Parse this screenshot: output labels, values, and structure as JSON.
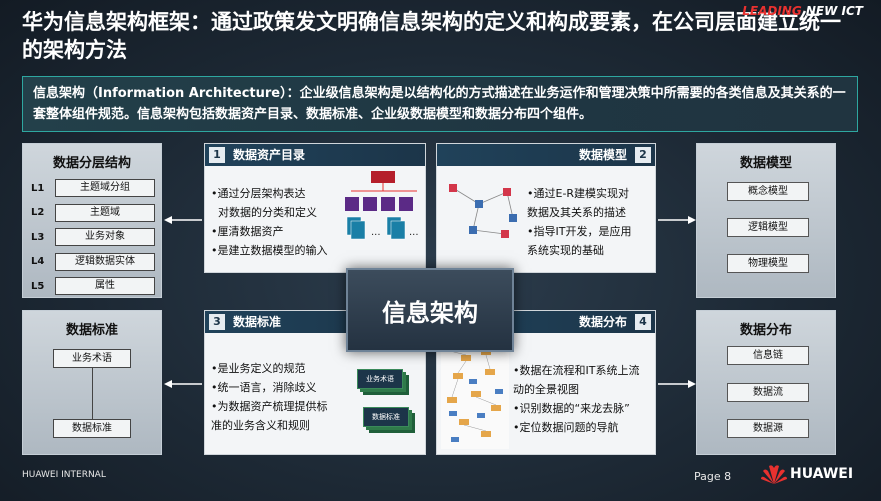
{
  "header": {
    "title": "华为信息架构框架：通过政策发文明确信息架构的定义和构成要素，在公司层面建立统一的架构方法",
    "tag_lead": "LEADING",
    "tag_ict": " NEW ICT"
  },
  "definition": {
    "text": "信息架构（Information Architecture）：企业级信息架构是以结构化的方式描述在业务运作和管理决策中所需要的各类信息及其关系的一套整体组件规范。信息架构包括数据资产目录、数据标准、企业级数据模型和数据分布四个组件。"
  },
  "left_top": {
    "title": "数据分层结构",
    "layers": [
      {
        "level": "L1",
        "label": "主题域分组"
      },
      {
        "level": "L2",
        "label": "主题域"
      },
      {
        "level": "L3",
        "label": "业务对象"
      },
      {
        "level": "L4",
        "label": "逻辑数据实体"
      },
      {
        "level": "L5",
        "label": "属性"
      }
    ]
  },
  "left_bottom": {
    "title": "数据标准",
    "items": [
      "业务术语",
      "数据标准"
    ]
  },
  "right_top": {
    "title": "数据模型",
    "items": [
      "概念模型",
      "逻辑模型",
      "物理模型"
    ]
  },
  "right_bottom": {
    "title": "数据分布",
    "items": [
      "信息链",
      "数据流",
      "数据源"
    ]
  },
  "panels": {
    "p1": {
      "num": "1",
      "title": "数据资产目录",
      "bullets": [
        "•通过分层架构表达",
        "  对数据的分类和定义",
        "•厘清数据资产",
        "•是建立数据模型的输入"
      ]
    },
    "p2": {
      "num": "2",
      "title": "数据模型",
      "bullets": [
        "•通过E-R建模实现对",
        "数据及其关系的描述",
        "•指导IT开发，是应用",
        "系统实现的基础"
      ]
    },
    "p3": {
      "num": "3",
      "title": "数据标准",
      "bullets": [
        "•是业务定义的规范",
        "•统一语言，消除歧义",
        "•为数据资产梳理提供标",
        "准的业务含义和规则"
      ],
      "stack_labels": [
        "业务术语",
        "数据标准"
      ]
    },
    "p4": {
      "num": "4",
      "title": "数据分布",
      "bullets": [
        "•数据在流程和IT系统上流",
        "动的全景视图",
        "•识别数据的“来龙去脉”",
        "•定位数据问题的导航"
      ]
    }
  },
  "center": {
    "label": "信息架构"
  },
  "footer": {
    "internal": "HUAWEI INTERNAL",
    "page": "Page 8",
    "brand": "HUAWEI"
  },
  "colors": {
    "accent_teal": "#2ea7a0",
    "panel_header": "#1c3549",
    "huawei_red": "#e8312f"
  }
}
